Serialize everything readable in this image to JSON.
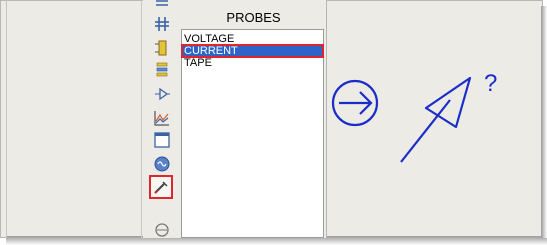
{
  "panel": {
    "title": "PROBES",
    "items": [
      {
        "label": "VOLTAGE"
      },
      {
        "label": "CURRENT"
      },
      {
        "label": "TAPE"
      }
    ],
    "selected_index": 1
  },
  "toolbar": {
    "tools": [
      {
        "icon": "junction-dot-icon"
      },
      {
        "icon": "wire-label-icon"
      },
      {
        "icon": "component-icon"
      },
      {
        "icon": "terminals-icon"
      },
      {
        "icon": "generator-icon"
      },
      {
        "icon": "graph-icon"
      },
      {
        "icon": "tape-recorder-icon"
      },
      {
        "icon": "virtual-instrument-icon"
      },
      {
        "icon": "probe-pen-icon"
      },
      {
        "icon": "device-pin-icon"
      }
    ],
    "selected_tool": "probe-pen-icon"
  },
  "annotation": {
    "question_mark": "?",
    "color": "#1a2dc9"
  },
  "colors": {
    "highlight": "#e0262a",
    "selection": "#2d64c8",
    "background": "#ecebe6"
  }
}
